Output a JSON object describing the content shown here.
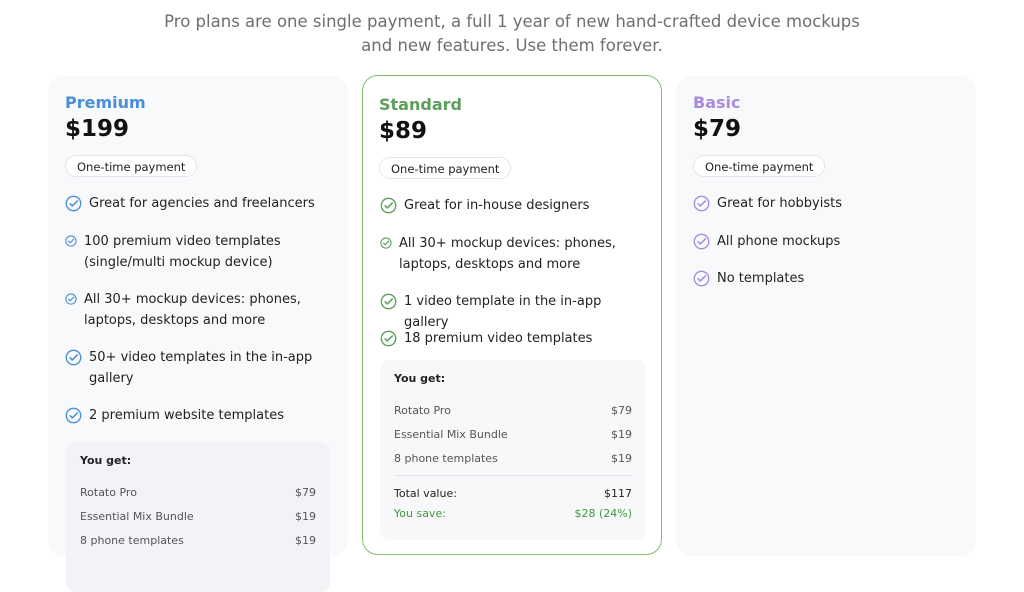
{
  "intro": "Pro plans are one single payment, a full 1 year of new hand-crafted device mockups and new features. Use them forever.",
  "colors": {
    "premium": "#4a8fd6",
    "standard": "#5aa05a",
    "basic": "#a98be0",
    "save": "#3d9a3a"
  },
  "plans": [
    {
      "name": "Premium",
      "price": "$199",
      "badge": "One-time payment",
      "features": [
        "Great for agencies and freelancers",
        "100 premium video templates (single/multi mockup device)",
        "All 30+ mockup devices: phones, laptops, desktops and more",
        "50+ video templates in the in-app gallery",
        "2 premium website templates"
      ],
      "you_get_label": "You get:",
      "items": [
        {
          "name": "Rotato Pro",
          "price": "$79"
        },
        {
          "name": "Essential Mix Bundle",
          "price": "$19"
        },
        {
          "name": "8 phone templates",
          "price": "$19"
        }
      ]
    },
    {
      "name": "Standard",
      "price": "$89",
      "badge": "One-time payment",
      "features": [
        "Great for in-house designers",
        "All 30+ mockup devices: phones, laptops, desktops and more",
        "1 video template in the in-app gallery",
        "18 premium video templates"
      ],
      "you_get_label": "You get:",
      "items": [
        {
          "name": "Rotato Pro",
          "price": "$79"
        },
        {
          "name": "Essential Mix Bundle",
          "price": "$19"
        },
        {
          "name": "8 phone templates",
          "price": "$19"
        }
      ],
      "total_label": "Total value:",
      "total_value": "$117",
      "save_label": "You save:",
      "save_value": "$28 (24%)"
    },
    {
      "name": "Basic",
      "price": "$79",
      "badge": "One-time payment",
      "features": [
        "Great for hobbyists",
        "All phone mockups",
        "No templates"
      ]
    }
  ]
}
